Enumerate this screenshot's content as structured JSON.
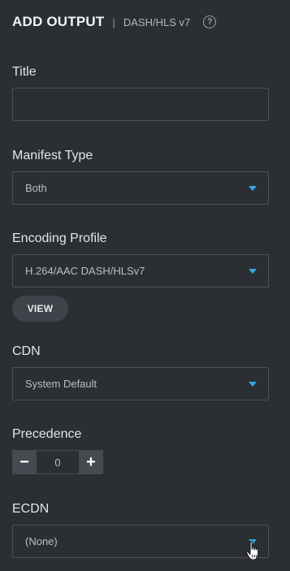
{
  "header": {
    "title": "ADD OUTPUT",
    "separator": "|",
    "subtitle": "DASH/HLS v7",
    "help_icon": "question-circle-icon"
  },
  "fields": {
    "title": {
      "label": "Title",
      "value": "",
      "placeholder": ""
    },
    "manifest_type": {
      "label": "Manifest Type",
      "value": "Both"
    },
    "encoding_profile": {
      "label": "Encoding Profile",
      "value": "H.264/AAC DASH/HLSv7",
      "view_button": "VIEW"
    },
    "cdn": {
      "label": "CDN",
      "value": "System Default"
    },
    "precedence": {
      "label": "Precedence",
      "value": "0",
      "minus": "−",
      "plus": "+"
    },
    "ecdn": {
      "label": "ECDN",
      "value": "(None)"
    }
  },
  "colors": {
    "background": "#2b2f33",
    "border": "#4b5157",
    "accent_caret": "#31a8e6",
    "button": "#3e444a"
  }
}
